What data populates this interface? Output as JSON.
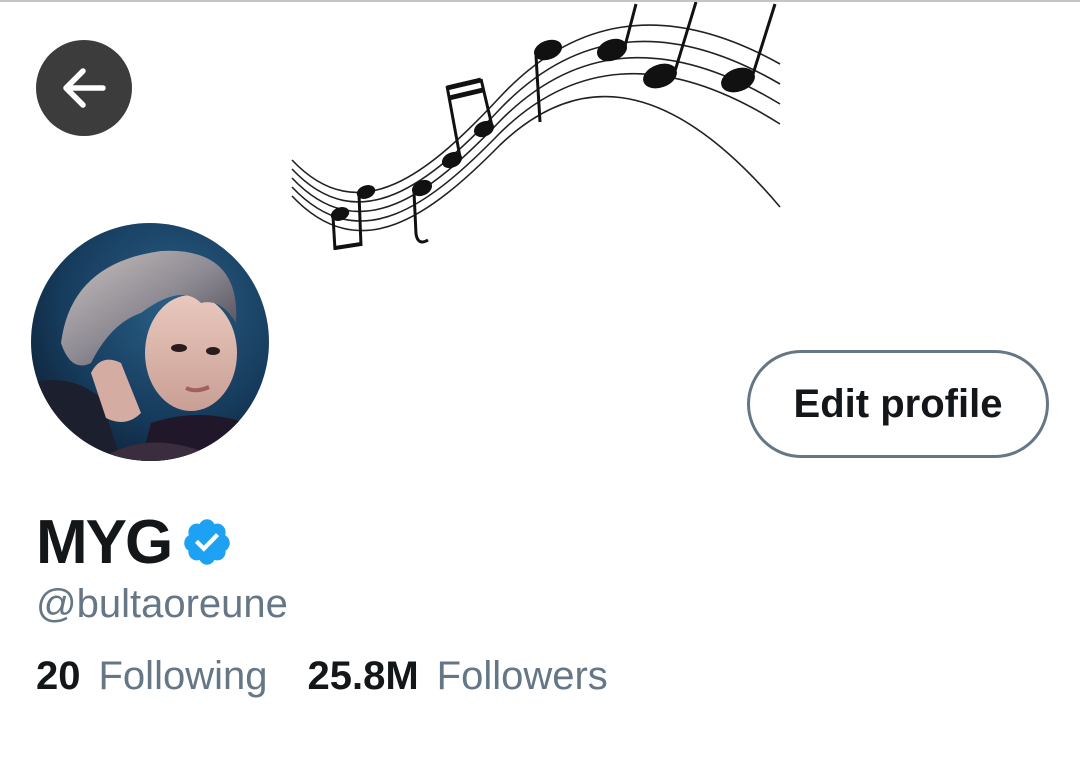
{
  "profile": {
    "display_name": "MYG",
    "handle": "@bultaoreune",
    "verified": true
  },
  "actions": {
    "edit_profile_label": "Edit profile"
  },
  "stats": {
    "following_count": "20",
    "following_label": "Following",
    "followers_count": "25.8M",
    "followers_label": "Followers"
  },
  "colors": {
    "text_primary": "#14171a",
    "text_secondary": "#657786",
    "verified_blue": "#1da1f2",
    "back_button_bg": "#3c3c3c"
  },
  "icons": {
    "back": "arrow-left-icon",
    "verified": "verified-badge-icon",
    "banner": "music-notes-staff"
  }
}
